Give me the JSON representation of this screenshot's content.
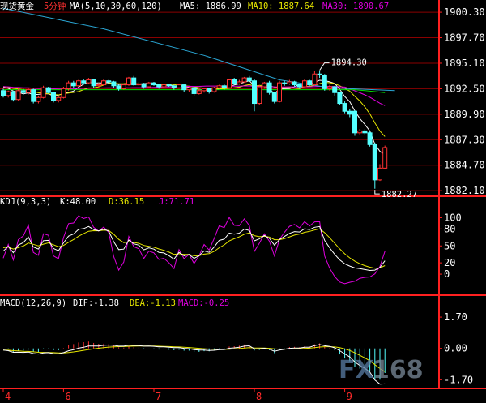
{
  "chart_data": {
    "type": "candlestick",
    "instrument": "现货黄金",
    "period": "5分钟",
    "main": {
      "ma_label": "MA(5,10,30,60,120)",
      "ma_values": [
        {
          "label": "MA5: 1886.99",
          "color": "#ffffff"
        },
        {
          "label": "MA10: 1887.64",
          "color": "#e6e600"
        },
        {
          "label": "MA30: 1890.67",
          "color": "#e000e0"
        }
      ],
      "y_ticks": [
        {
          "value": 1900.3,
          "label": "1900.30"
        },
        {
          "value": 1897.7,
          "label": "1897.70"
        },
        {
          "value": 1895.1,
          "label": "1895.10"
        },
        {
          "value": 1892.5,
          "label": "1892.50"
        },
        {
          "value": 1889.9,
          "label": "1889.90"
        },
        {
          "value": 1887.3,
          "label": "1887.30"
        },
        {
          "value": 1884.7,
          "label": "1884.70"
        },
        {
          "value": 1882.1,
          "label": "1882.10"
        }
      ],
      "ylim": [
        1881.7,
        1901.3
      ],
      "annotations": [
        {
          "text": "1894.30",
          "at_bar": 63,
          "value": 1894.3
        },
        {
          "text": "1882.27",
          "at_bar": 74,
          "value": 1882.27
        }
      ],
      "candles": [
        [
          1892.3,
          1891.8,
          1892.5,
          1891.6
        ],
        [
          1891.8,
          1892.2,
          1892.3,
          1891.6
        ],
        [
          1892.2,
          1891.4,
          1892.3,
          1891.2
        ],
        [
          1891.4,
          1892.3,
          1892.6,
          1891.3
        ],
        [
          1892.3,
          1892.1,
          1892.5,
          1891.9
        ],
        [
          1892.1,
          1892.4,
          1892.6,
          1891.9
        ],
        [
          1892.4,
          1891.2,
          1892.5,
          1891.0
        ],
        [
          1891.2,
          1891.6,
          1891.8,
          1891.0
        ],
        [
          1891.6,
          1892.6,
          1892.8,
          1891.5
        ],
        [
          1892.6,
          1892.1,
          1892.7,
          1892.0
        ],
        [
          1892.1,
          1891.3,
          1892.2,
          1891.1
        ],
        [
          1891.3,
          1891.6,
          1891.7,
          1891.1
        ],
        [
          1891.6,
          1892.5,
          1892.7,
          1891.5
        ],
        [
          1892.5,
          1893.1,
          1893.3,
          1892.3
        ],
        [
          1893.1,
          1892.8,
          1893.3,
          1892.6
        ],
        [
          1892.8,
          1893.3,
          1893.4,
          1892.7
        ],
        [
          1893.3,
          1893.1,
          1893.5,
          1892.9
        ],
        [
          1893.1,
          1893.4,
          1893.6,
          1893.0
        ],
        [
          1893.4,
          1892.8,
          1893.5,
          1892.6
        ],
        [
          1892.8,
          1892.9,
          1893.1,
          1892.7
        ],
        [
          1892.9,
          1893.3,
          1893.5,
          1892.8
        ],
        [
          1893.3,
          1893.2,
          1893.4,
          1893.0
        ],
        [
          1893.2,
          1892.8,
          1893.3,
          1892.6
        ],
        [
          1892.8,
          1892.5,
          1892.9,
          1892.3
        ],
        [
          1892.5,
          1892.9,
          1893.0,
          1892.4
        ],
        [
          1892.9,
          1893.6,
          1893.7,
          1892.8
        ],
        [
          1893.6,
          1892.9,
          1893.8,
          1892.8
        ],
        [
          1892.9,
          1893.0,
          1893.2,
          1892.8
        ],
        [
          1893.0,
          1892.7,
          1893.1,
          1892.5
        ],
        [
          1892.7,
          1893.1,
          1893.2,
          1892.6
        ],
        [
          1893.1,
          1892.9,
          1893.2,
          1892.8
        ],
        [
          1892.9,
          1892.7,
          1893.0,
          1892.5
        ],
        [
          1892.7,
          1892.9,
          1893.0,
          1892.6
        ],
        [
          1892.9,
          1892.8,
          1893.0,
          1892.7
        ],
        [
          1892.8,
          1892.6,
          1892.9,
          1892.4
        ],
        [
          1892.6,
          1892.9,
          1893.0,
          1892.5
        ],
        [
          1892.9,
          1892.4,
          1893.0,
          1892.2
        ],
        [
          1892.4,
          1892.6,
          1892.7,
          1892.2
        ],
        [
          1892.6,
          1892.0,
          1892.7,
          1891.8
        ],
        [
          1892.0,
          1892.3,
          1892.5,
          1891.9
        ],
        [
          1892.3,
          1892.5,
          1892.6,
          1892.1
        ],
        [
          1892.5,
          1892.2,
          1892.6,
          1892.0
        ],
        [
          1892.2,
          1892.6,
          1892.7,
          1892.1
        ],
        [
          1892.6,
          1892.8,
          1892.9,
          1892.5
        ],
        [
          1892.8,
          1892.6,
          1893.0,
          1892.4
        ],
        [
          1892.6,
          1893.4,
          1893.5,
          1892.5
        ],
        [
          1893.4,
          1893.0,
          1893.6,
          1892.9
        ],
        [
          1893.0,
          1893.2,
          1893.4,
          1892.9
        ],
        [
          1893.2,
          1893.6,
          1893.7,
          1893.1
        ],
        [
          1893.6,
          1893.3,
          1893.8,
          1893.2
        ],
        [
          1893.3,
          1891.0,
          1893.5,
          1890.2
        ],
        [
          1891.0,
          1892.7,
          1892.9,
          1890.8
        ],
        [
          1892.7,
          1893.1,
          1893.2,
          1892.5
        ],
        [
          1893.1,
          1892.1,
          1893.3,
          1891.9
        ],
        [
          1892.1,
          1891.2,
          1892.2,
          1891.0
        ],
        [
          1891.2,
          1893.1,
          1893.3,
          1891.1
        ],
        [
          1893.1,
          1893.0,
          1893.3,
          1892.8
        ],
        [
          1893.0,
          1893.2,
          1893.4,
          1892.9
        ],
        [
          1893.2,
          1892.9,
          1893.3,
          1892.7
        ],
        [
          1892.9,
          1892.7,
          1893.0,
          1892.5
        ],
        [
          1892.7,
          1893.3,
          1893.5,
          1892.6
        ],
        [
          1893.3,
          1892.9,
          1893.4,
          1892.8
        ],
        [
          1892.9,
          1894.0,
          1894.3,
          1892.8
        ],
        [
          1894.0,
          1893.9,
          1894.3,
          1893.6
        ],
        [
          1893.9,
          1892.5,
          1894.0,
          1892.3
        ],
        [
          1892.5,
          1892.7,
          1892.9,
          1892.3
        ],
        [
          1892.7,
          1892.1,
          1892.8,
          1891.8
        ],
        [
          1892.1,
          1891.0,
          1892.2,
          1890.8
        ],
        [
          1891.0,
          1890.2,
          1891.2,
          1890.0
        ],
        [
          1890.2,
          1889.9,
          1890.4,
          1889.6
        ],
        [
          1890.2,
          1888.0,
          1890.3,
          1887.7
        ],
        [
          1888.0,
          1888.2,
          1888.4,
          1887.8
        ],
        [
          1888.2,
          1888.0,
          1888.4,
          1887.8
        ],
        [
          1888.0,
          1886.8,
          1888.2,
          1886.6
        ],
        [
          1886.8,
          1883.2,
          1887.0,
          1882.3
        ],
        [
          1883.2,
          1884.4,
          1884.8,
          1883.1
        ],
        [
          1884.4,
          1886.5,
          1886.7,
          1884.3
        ]
      ],
      "ma120": [
        {
          "bar": 0,
          "value": 1900.7
        },
        {
          "bar": 20,
          "value": 1898.6
        },
        {
          "bar": 40,
          "value": 1895.9
        },
        {
          "bar": 55,
          "value": 1893.4
        },
        {
          "bar": 65,
          "value": 1892.6
        },
        {
          "bar": 78,
          "value": 1892.3
        }
      ]
    },
    "kdj": {
      "label": "KDJ(9,3,3)",
      "k_label": "K:48.00",
      "d_label": "D:36.15",
      "j_label": "J:71.71",
      "y_ticks": [
        {
          "value": 100,
          "label": "100"
        },
        {
          "value": 80,
          "label": "80"
        },
        {
          "value": 50,
          "label": "50"
        },
        {
          "value": 20,
          "label": "20"
        },
        {
          "value": 0,
          "label": "0"
        }
      ],
      "ylim": [
        -20,
        115
      ]
    },
    "macd": {
      "label": "MACD(12,26,9)",
      "dif_label": "DIF:-1.38",
      "dea_label": "DEA:-1.13",
      "macd_label": "MACD:-0.25",
      "y_ticks": [
        {
          "value": 1.7,
          "label": "1.70"
        },
        {
          "value": 0.0,
          "label": "0.00"
        },
        {
          "value": -1.7,
          "label": "-1.70"
        }
      ],
      "ylim": [
        -1.95,
        2.1
      ]
    },
    "x_labels": [
      {
        "label": "4",
        "at_bar": 0
      },
      {
        "label": "6",
        "at_bar": 12
      },
      {
        "label": "7",
        "at_bar": 30
      },
      {
        "label": "8",
        "at_bar": 50
      },
      {
        "label": "9",
        "at_bar": 68
      }
    ],
    "colors": {
      "up": "#ff3232",
      "down": "#54ffff",
      "ma5": "#ffffff",
      "ma10": "#e6e600",
      "ma30": "#e000e0",
      "ma60": "#00dd00",
      "ma120": "#2aa6d4",
      "grid": "#8b0000",
      "frame": "#ff2020"
    }
  },
  "watermark": {
    "part1": "FX",
    "part2": "168"
  }
}
